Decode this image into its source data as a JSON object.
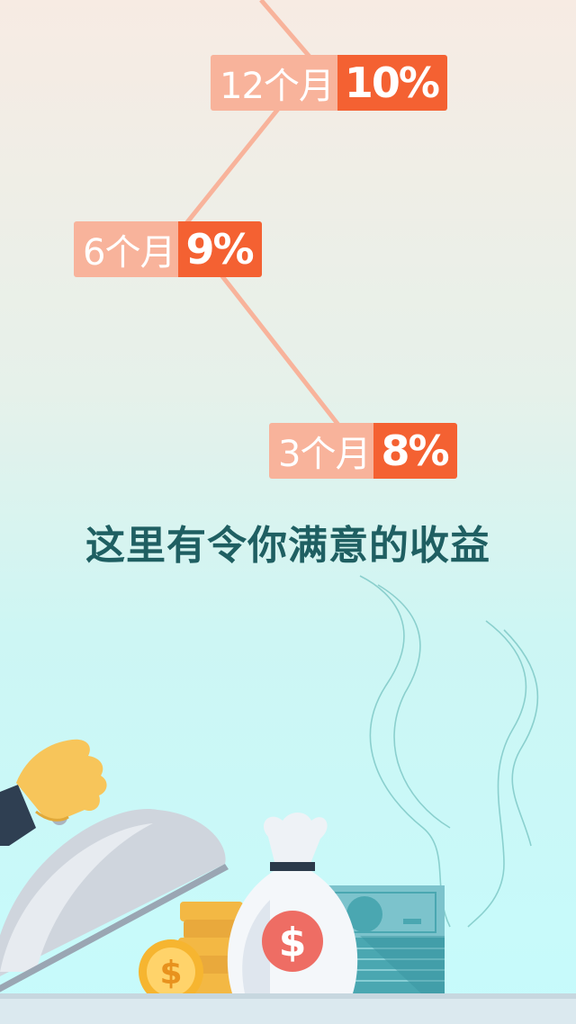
{
  "rates": [
    {
      "term": "12个月",
      "value": "10%"
    },
    {
      "term": "6个月",
      "value": "9%"
    },
    {
      "term": "3个月",
      "value": "8%"
    }
  ],
  "headline": "这里有令你满意的收益",
  "colors": {
    "tag_term_bg": "#f8b39b",
    "tag_value_bg": "#f46132",
    "headline": "#1f5f62",
    "line": "#f8b39b"
  },
  "icons": [
    "hand-icon",
    "serving-cloche-icon",
    "money-bag-icon",
    "dollar-coin-icon",
    "banknote-stack-icon",
    "coin-stack-icon",
    "steam-icon"
  ]
}
